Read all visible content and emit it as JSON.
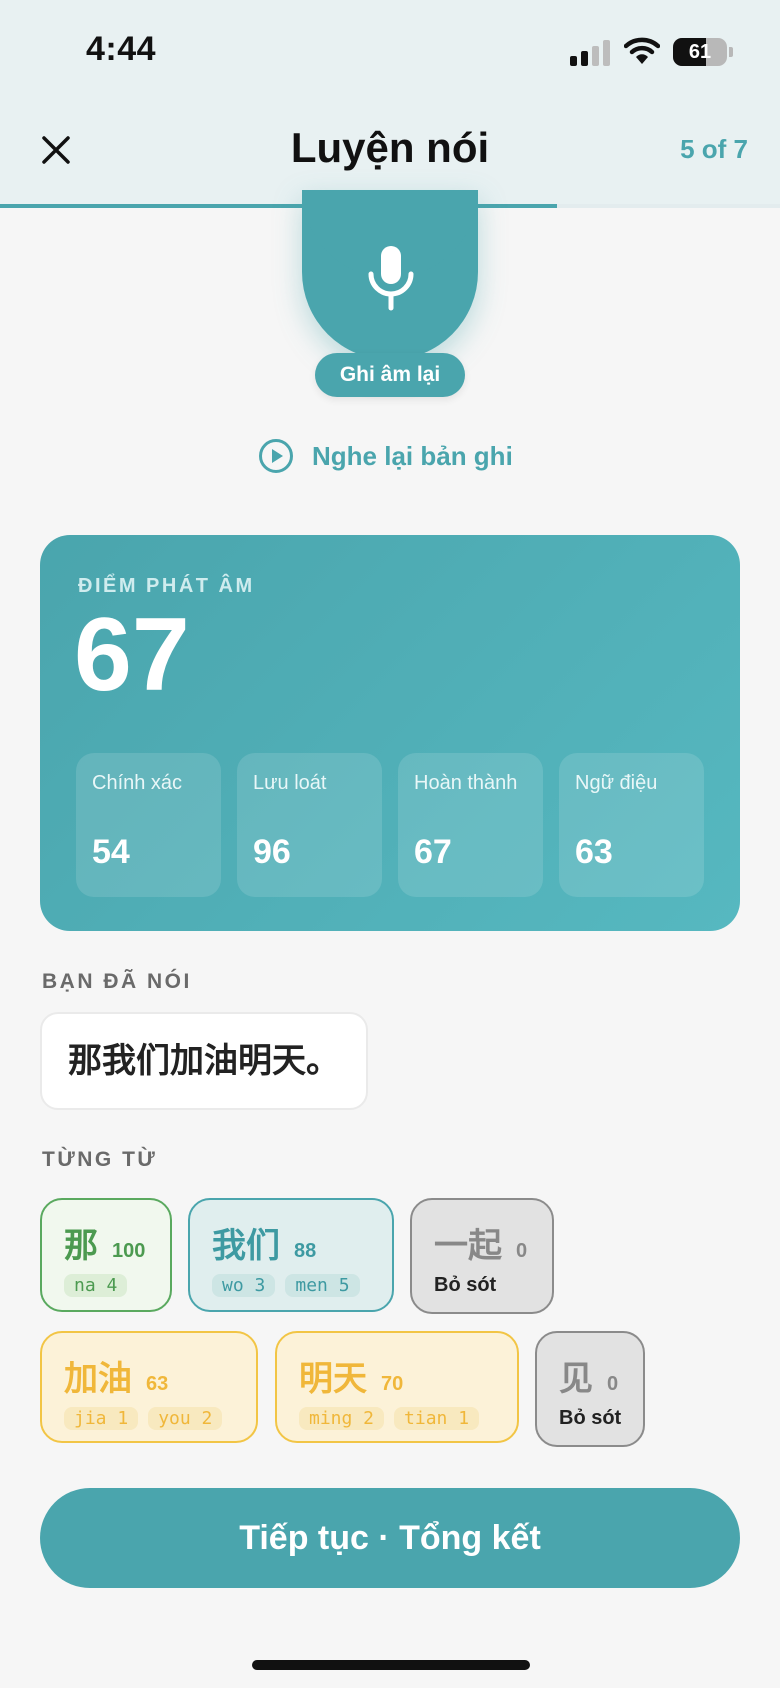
{
  "status_bar": {
    "time": "4:44",
    "battery": "61",
    "battery_level": 0.61
  },
  "header": {
    "title": "Luyện nói",
    "step": "5 of 7",
    "progress": 0.714
  },
  "mic": {
    "icon": "microphone-icon",
    "rerecord_label": "Ghi âm lại"
  },
  "playback": {
    "icon": "play-circle-icon",
    "label": "Nghe lại bản ghi"
  },
  "score": {
    "label": "ĐIỂM PHÁT ÂM",
    "value": "67",
    "metrics": [
      {
        "label": "Chính xác",
        "value": "54"
      },
      {
        "label": "Lưu loát",
        "value": "96"
      },
      {
        "label": "Hoàn thành",
        "value": "67"
      },
      {
        "label": "Ngữ điệu",
        "value": "63"
      }
    ]
  },
  "said": {
    "label": "BẠN ĐÃ NÓI",
    "text": "那我们加油明天。"
  },
  "words": {
    "label": "TỪNG TỪ",
    "items": [
      {
        "text": "那",
        "score": "100",
        "syllables": [
          "na 4"
        ],
        "status": "good",
        "color": "#5aa95f"
      },
      {
        "text": "我们",
        "score": "88",
        "syllables": [
          "wo 3",
          "men 5"
        ],
        "status": "good",
        "color": "#4aa5ad"
      },
      {
        "text": "一起",
        "score": "0",
        "missed_label": "Bỏ sót",
        "status": "missed",
        "color": "#8b8b8b"
      },
      {
        "text": "加油",
        "score": "63",
        "syllables": [
          "jia 1",
          "you 2"
        ],
        "status": "fair",
        "color": "#f2c545"
      },
      {
        "text": "明天",
        "score": "70",
        "syllables": [
          "ming 2",
          "tian 1"
        ],
        "status": "fair",
        "color": "#f2c545"
      },
      {
        "text": "见",
        "score": "0",
        "missed_label": "Bỏ sót",
        "status": "missed",
        "color": "#8b8b8b"
      }
    ]
  },
  "continue_button": {
    "label": "Tiếp tục · Tổng kết"
  },
  "colors": {
    "accent": "#4aa5ad",
    "good": "#5aa95f",
    "fair": "#f2c545",
    "missed": "#8b8b8b"
  }
}
